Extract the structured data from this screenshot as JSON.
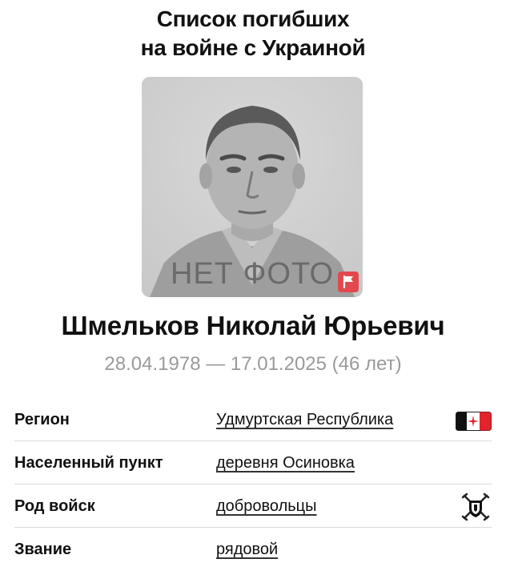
{
  "header": {
    "title_line1": "Список погибших",
    "title_line2": "на войне с Украиной"
  },
  "photo": {
    "placeholder_text": "НЕТ ФОТО",
    "badge_icon": "flag-icon"
  },
  "person": {
    "name": "Шмельков Николай Юрьевич",
    "dates": "28.04.1978 — 17.01.2025 (46 лет)"
  },
  "details": [
    {
      "label": "Регион",
      "value": "Удмуртская Республика",
      "icon": "udmurtia-flag-icon"
    },
    {
      "label": "Населенный пункт",
      "value": "деревня Осиновка"
    },
    {
      "label": "Род войск",
      "value": "добровольцы",
      "icon": "volunteers-emblem-icon"
    },
    {
      "label": "Звание",
      "value": "рядовой"
    }
  ],
  "colors": {
    "badge": "#e2484e",
    "dates_text": "#9a9a9a",
    "photo_bg": "#d2d2d2"
  }
}
